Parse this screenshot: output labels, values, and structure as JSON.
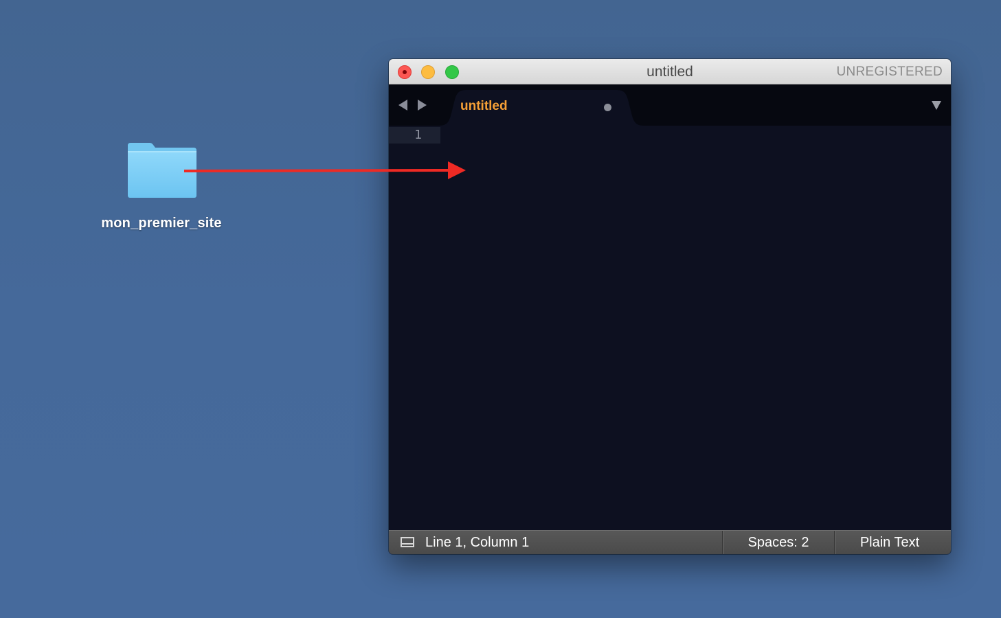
{
  "desktop": {
    "folder": {
      "label": "mon_premier_site",
      "icon": "folder-icon",
      "color": "#7fd0f6"
    },
    "drag_arrow": {
      "color": "#ee2a24"
    }
  },
  "window": {
    "title": "untitled",
    "license_status": "UNREGISTERED",
    "traffic_lights": {
      "close": "#fc5753",
      "minimize": "#fdbc40",
      "zoom": "#33c748"
    },
    "tabs": [
      {
        "label": "untitled",
        "modified": true,
        "active": true,
        "color": "#f6a036"
      }
    ],
    "editor": {
      "line_numbers": [
        "1"
      ],
      "background": "#0d1020"
    },
    "statusbar": {
      "position": "Line 1, Column 1",
      "indentation": "Spaces: 2",
      "syntax": "Plain Text"
    }
  }
}
